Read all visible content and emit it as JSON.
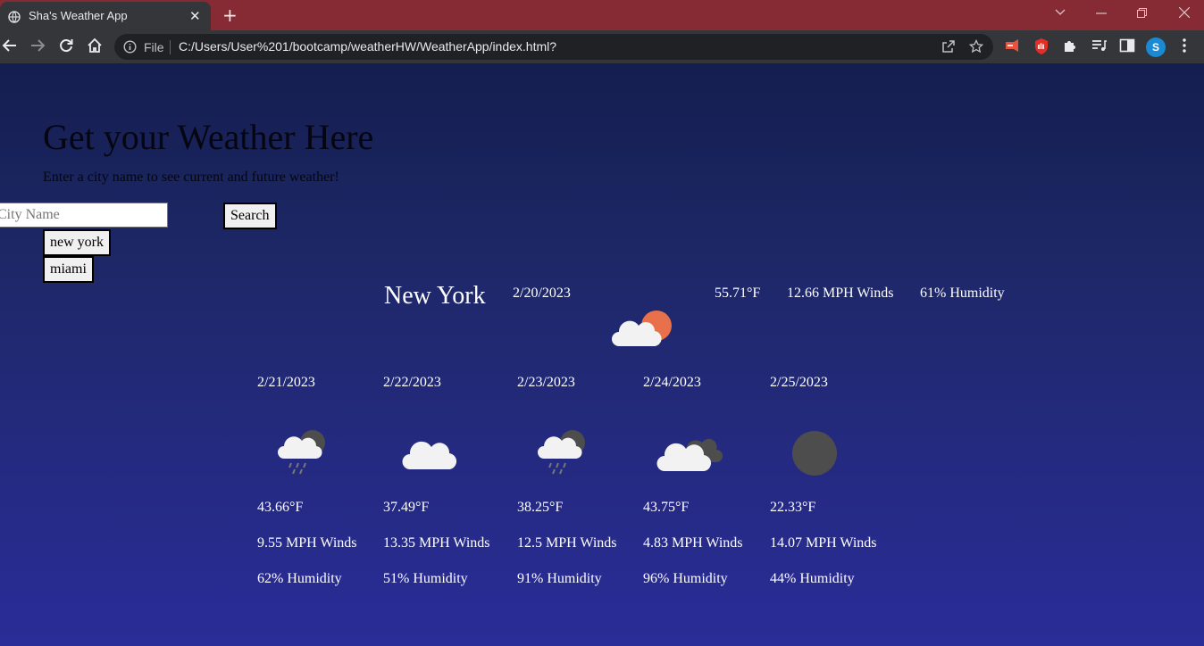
{
  "browser": {
    "tab_title": "Sha's Weather App",
    "tab_close": "✕",
    "new_tab": "+",
    "url_scheme": "File",
    "url": "C:/Users/User%201/bootcamp/weatherHW/WeatherApp/index.html?",
    "profile_initial": "S"
  },
  "page": {
    "heading": "Get your Weather Here",
    "subtitle": "Enter a city name to see current and future weather!",
    "search_placeholder": "City Name",
    "search_button": "Search",
    "history": [
      "new york",
      "miami"
    ]
  },
  "current": {
    "city": "New York",
    "date": "2/20/2023",
    "temp": "55.71°F",
    "wind": "12.66 MPH Winds",
    "humidity": "61% Humidity",
    "icon": "partly-cloudy-sun-icon"
  },
  "forecast": [
    {
      "date": "2/21/2023",
      "icon": "rain-cloud-icon",
      "temp": "43.66°F",
      "wind": "9.55 MPH Winds",
      "humidity": "62% Humidity"
    },
    {
      "date": "2/22/2023",
      "icon": "cloud-icon",
      "temp": "37.49°F",
      "wind": "13.35 MPH Winds",
      "humidity": "51% Humidity"
    },
    {
      "date": "2/23/2023",
      "icon": "rain-cloud-icon",
      "temp": "38.25°F",
      "wind": "12.5 MPH Winds",
      "humidity": "91% Humidity"
    },
    {
      "date": "2/24/2023",
      "icon": "broken-clouds-icon",
      "temp": "43.75°F",
      "wind": "4.83 MPH Winds",
      "humidity": "96% Humidity"
    },
    {
      "date": "2/25/2023",
      "icon": "clear-night-icon",
      "temp": "22.33°F",
      "wind": "14.07 MPH Winds",
      "humidity": "44% Humidity"
    }
  ],
  "colors": {
    "tabbar": "#862a33",
    "toolbar": "#35363a",
    "page_top": "#141e4f",
    "page_bottom": "#2a2c98",
    "sun": "#e8704a"
  }
}
